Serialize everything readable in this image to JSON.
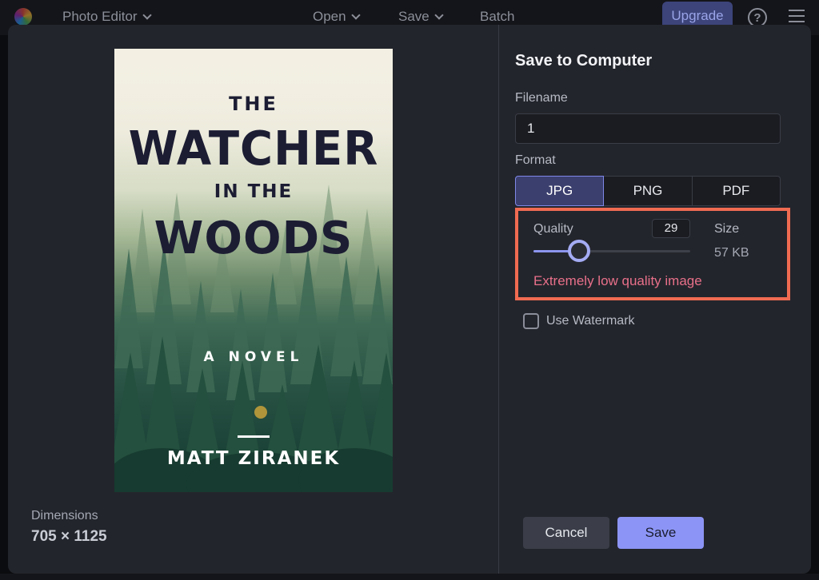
{
  "topbar": {
    "app_title": "Photo Editor",
    "open_label": "Open",
    "save_label": "Save",
    "batch_label": "Batch",
    "upgrade_label": "Upgrade",
    "help_glyph": "?"
  },
  "preview": {
    "cover": {
      "line1": "THE",
      "line2": "WATCHER",
      "line3": "IN THE",
      "line4": "WOODS",
      "subtitle": "A NOVEL",
      "author": "MATT ZIRANEK"
    },
    "dimensions_label": "Dimensions",
    "dimensions_value": "705 × 1125"
  },
  "dialog": {
    "title": "Save to Computer",
    "filename_label": "Filename",
    "filename_value": "1",
    "format_label": "Format",
    "formats": [
      "JPG",
      "PNG",
      "PDF"
    ],
    "selected_format": "JPG",
    "quality_label": "Quality",
    "quality_value": "29",
    "quality_percent": 29,
    "size_label": "Size",
    "size_value": "57 KB",
    "warning": "Extremely low quality image",
    "watermark_label": "Use Watermark",
    "watermark_checked": false,
    "cancel_label": "Cancel",
    "save_label": "Save"
  },
  "colors": {
    "accent": "#8c95f5",
    "highlight_border": "#f06b52",
    "warning_text": "#e8708a",
    "modal_bg": "#23252c"
  },
  "icons": {
    "help": "help-circle-icon",
    "menu": "hamburger-menu-icon",
    "chevron": "chevron-down-icon",
    "logo": "app-logo-icon"
  }
}
